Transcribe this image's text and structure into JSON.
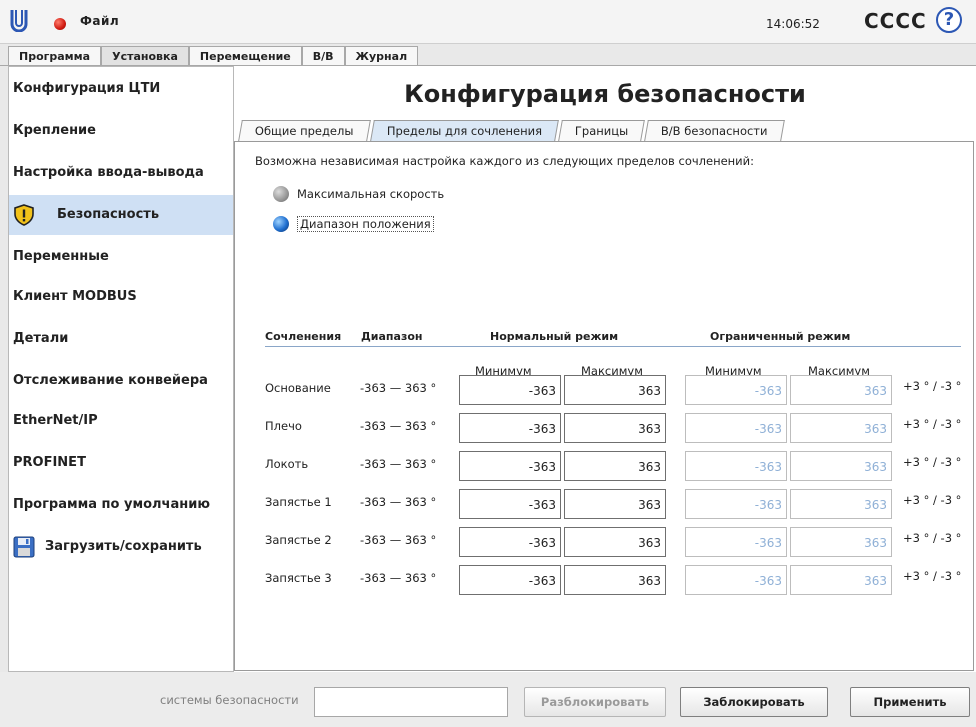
{
  "header": {
    "file_menu": "Файл",
    "clock": "14:06:52",
    "robot_name": "CCCC",
    "help": "?"
  },
  "main_tabs": [
    {
      "label": "Программа",
      "active": false
    },
    {
      "label": "Установка",
      "active": true
    },
    {
      "label": "Перемещение",
      "active": false
    },
    {
      "label": "В/В",
      "active": false
    },
    {
      "label": "Журнал",
      "active": false
    }
  ],
  "sidebar": {
    "items": [
      {
        "label": "Конфигурация ЦТИ"
      },
      {
        "label": "Крепление"
      },
      {
        "label": "Настройка ввода-вывода"
      },
      {
        "label": "Безопасность",
        "icon": "warning-shield-icon",
        "active": true
      },
      {
        "label": "Переменные"
      },
      {
        "label": "Клиент MODBUS"
      },
      {
        "label": "Детали"
      },
      {
        "label": "Отслеживание конвейера"
      },
      {
        "label": "EtherNet/IP"
      },
      {
        "label": "PROFINET"
      },
      {
        "label": "Программа по умолчанию"
      },
      {
        "label": "Загрузить/сохранить",
        "icon": "floppy-disk-icon"
      }
    ]
  },
  "content": {
    "title": "Конфигурация безопасности",
    "subtabs": [
      {
        "label": "Общие пределы",
        "active": false
      },
      {
        "label": "Пределы для сочленения",
        "active": true
      },
      {
        "label": "Границы",
        "active": false
      },
      {
        "label": "В/В безопасности",
        "active": false
      }
    ],
    "description": "Возможна независимая настройка каждого из следующих пределов сочленений:",
    "options": [
      {
        "label": "Максимальная скорость",
        "selected": false
      },
      {
        "label": "Диапазон положения",
        "selected": true
      }
    ],
    "table": {
      "headers": {
        "joints": "Сочленения",
        "range": "Диапазон",
        "normal": "Нормальный режим",
        "limited": "Ограниченный режим",
        "min": "Минимум",
        "max": "Максимум"
      },
      "rows": [
        {
          "joint": "Основание",
          "range": "-363 — 363 °",
          "normal_min": "-363",
          "normal_max": "363",
          "limited_min": "-363",
          "limited_max": "363",
          "tolerance": "+3 ° / -3 °"
        },
        {
          "joint": "Плечо",
          "range": "-363 — 363 °",
          "normal_min": "-363",
          "normal_max": "363",
          "limited_min": "-363",
          "limited_max": "363",
          "tolerance": "+3 ° / -3 °"
        },
        {
          "joint": "Локоть",
          "range": "-363 — 363 °",
          "normal_min": "-363",
          "normal_max": "363",
          "limited_min": "-363",
          "limited_max": "363",
          "tolerance": "+3 ° / -3 °"
        },
        {
          "joint": "Запястье 1",
          "range": "-363 — 363 °",
          "normal_min": "-363",
          "normal_max": "363",
          "limited_min": "-363",
          "limited_max": "363",
          "tolerance": "+3 ° / -3 °"
        },
        {
          "joint": "Запястье 2",
          "range": "-363 — 363 °",
          "normal_min": "-363",
          "normal_max": "363",
          "limited_min": "-363",
          "limited_max": "363",
          "tolerance": "+3 ° / -3 °"
        },
        {
          "joint": "Запястье 3",
          "range": "-363 — 363 °",
          "normal_min": "-363",
          "normal_max": "363",
          "limited_min": "-363",
          "limited_max": "363",
          "tolerance": "+3 ° / -3 °"
        }
      ]
    }
  },
  "footer": {
    "password_label": "системы безопасности",
    "password_value": "",
    "unlock_label": "Разблокировать",
    "lock_label": "Заблокировать",
    "apply_label": "Применить"
  },
  "colors": {
    "active_sidebar": "#cfe0f4",
    "limited_text": "#8fb0d6",
    "help_accent": "#2c57b4",
    "estop_red": "#d01a10"
  }
}
